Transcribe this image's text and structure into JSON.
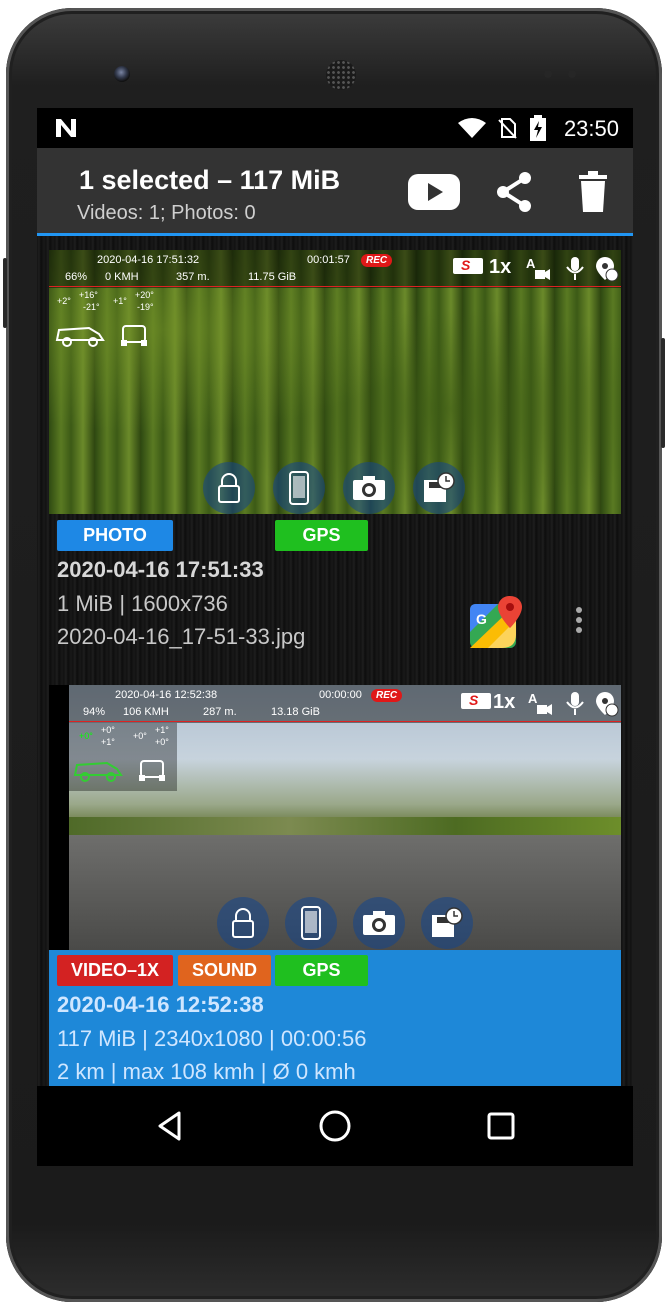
{
  "status": {
    "time": "23:50"
  },
  "appbar": {
    "title": "1 selected – 117 MiB",
    "subtitle": "Videos: 1; Photos: 0"
  },
  "items": [
    {
      "hud": {
        "datetime": "2020-04-16 17:51:32",
        "elapsed": "00:01:57",
        "rec": "REC",
        "battery": "66%",
        "speed": "0 KMH",
        "distance": "357 m.",
        "storage": "11.75 GiB",
        "zoom": "1x",
        "tilt": [
          "+2°",
          "+16°",
          "-21°",
          "+1°",
          "+20°",
          "-19°"
        ]
      },
      "tags": [
        "PHOTO",
        "GPS"
      ],
      "datetime": "2020-04-16 17:51:33",
      "details": "1 MiB | 1600x736",
      "filename": "2020-04-16_17-51-33.jpg"
    },
    {
      "hud": {
        "datetime": "2020-04-16 12:52:38",
        "elapsed": "00:00:00",
        "rec": "REC",
        "battery": "94%",
        "speed": "106 KMH",
        "distance": "287 m.",
        "storage": "13.18 GiB",
        "zoom": "1x",
        "tilt": [
          "+0°",
          "+0°",
          "+1°",
          "+0°",
          "+1°",
          "+0°"
        ]
      },
      "tags": [
        "VIDEO–1X",
        "SOUND",
        "GPS"
      ],
      "datetime": "2020-04-16 12:52:38",
      "details": "117 MiB | 2340x1080 | 00:00:56",
      "trip": "2 km | max 108 kmh | Ø 0 kmh"
    }
  ],
  "colors": {
    "accent": "#2196f3",
    "photo_tag": "#1e88e5",
    "gps_tag": "#1fbf1f",
    "video_tag": "#d32222",
    "sound_tag": "#e0641e",
    "selected_bg": "#1e88d8"
  },
  "icons": [
    "youtube-icon",
    "share-icon",
    "delete-icon",
    "lock-icon",
    "phone-icon",
    "camera-icon",
    "save-clock-icon",
    "maps-icon",
    "overflow-menu-icon",
    "back-icon",
    "home-icon",
    "recents-icon"
  ]
}
